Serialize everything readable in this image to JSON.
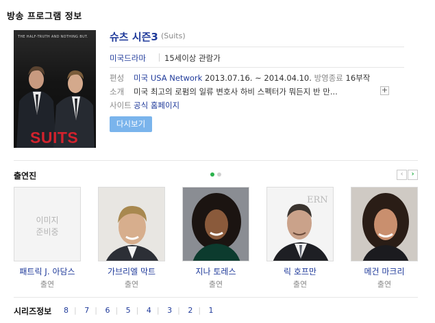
{
  "header": {
    "title": "방송 프로그램 정보"
  },
  "poster": {
    "tagline": "THE HALF-TRUTH AND NOTHING BUT.",
    "logo_text": "SUITS"
  },
  "program": {
    "title": "슈츠 시즌3",
    "original_title": "(Suits)",
    "genre": "미국드라마",
    "rating": "15세이상 관람가",
    "schedule_label": "편성",
    "schedule_network": "미국 USA Network",
    "schedule_dates": "2013.07.16. ~ 2014.04.10.",
    "schedule_status": "방영종료",
    "schedule_episodes": "16부작",
    "intro_label": "소개",
    "intro_text": "미국 최고의 로펌의 일류 변호사 하비 스펙터가 뭐든지 반 만...",
    "site_label": "사이트",
    "site_link": "공식 홈페이지",
    "replay_button": "다시보기"
  },
  "cast": {
    "title": "출연진",
    "pager_prev": "‹",
    "pager_next": "›",
    "members": [
      {
        "name": "패트릭 J. 아담스",
        "role": "출연",
        "no_image_text": "이미지 준비중"
      },
      {
        "name": "가브리엘 막트",
        "role": "출연"
      },
      {
        "name": "지나 토레스",
        "role": "출연"
      },
      {
        "name": "릭 호프만",
        "role": "출연"
      },
      {
        "name": "메건 마크리",
        "role": "출연"
      }
    ]
  },
  "series": {
    "title": "시리즈정보",
    "seasons": [
      "8",
      "7",
      "6",
      "5",
      "4",
      "3",
      "2",
      "1"
    ]
  },
  "colors": {
    "link": "#1f3a9a",
    "button": "#7ab4ec",
    "poster_logo": "#d2222d"
  }
}
